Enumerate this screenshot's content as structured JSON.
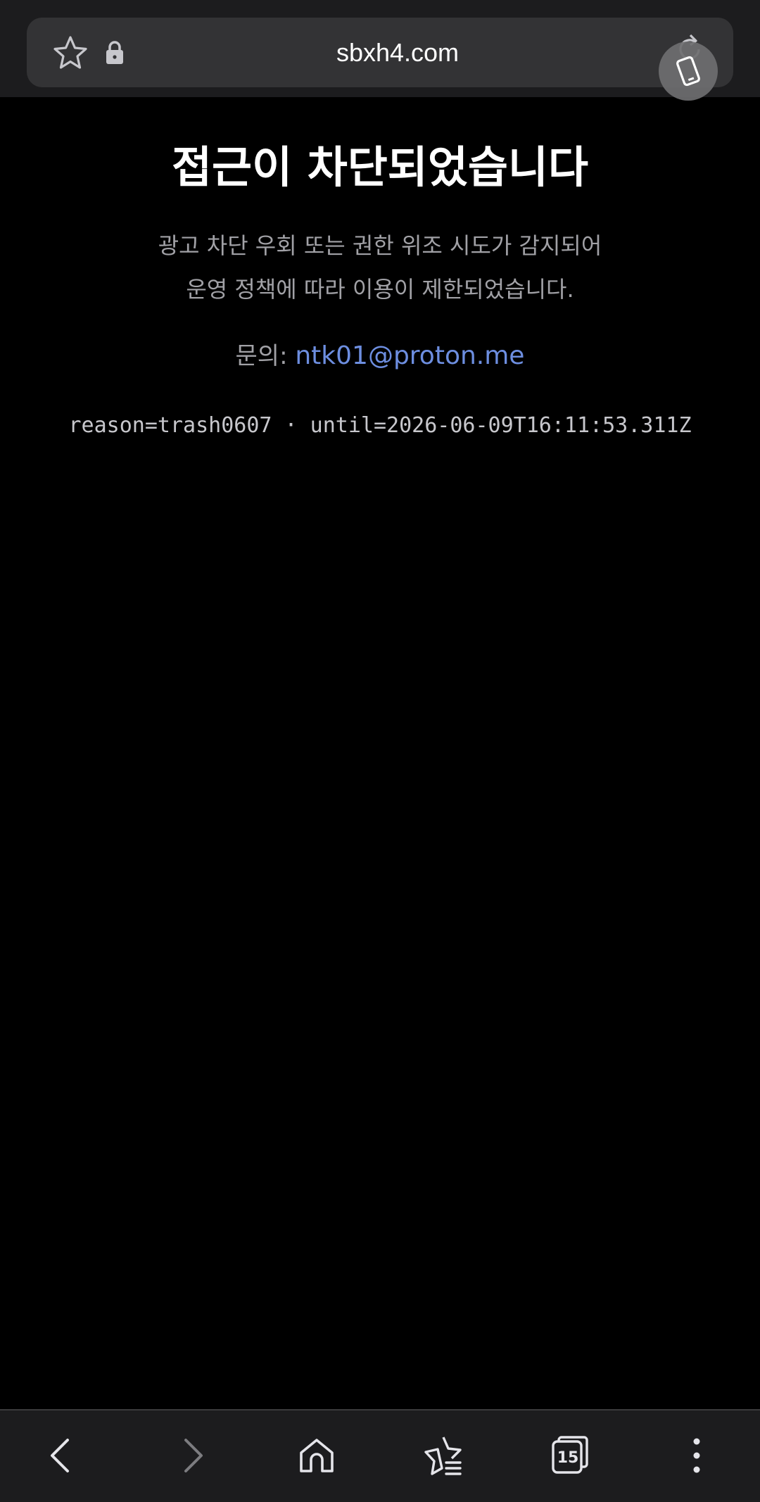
{
  "browser": {
    "url": "sbxh4.com",
    "icons": {
      "bookmark": "star-outline-icon",
      "security": "lock-icon",
      "reload": "reload-icon",
      "floating": "device-rotate-icon"
    }
  },
  "blocked": {
    "title": "접근이 차단되었습니다",
    "message_line1": "광고 차단 우회 또는 권한 위조 시도가 감지되어",
    "message_line2": "운영 정책에 따라 이용이 제한되었습니다.",
    "contact_label": "문의:",
    "contact_email": "ntk01@proton.me",
    "reason": "reason=trash0607 · until=2026-06-09T16:11:53.311Z"
  },
  "bottom_nav": {
    "tab_count": "15",
    "items": [
      "back-icon",
      "forward-icon",
      "home-icon",
      "bookmarks-icon",
      "tabs-icon",
      "more-icon"
    ]
  },
  "colors": {
    "background": "#000000",
    "bar": "#1c1c1e",
    "urlbar": "#333335",
    "link": "#6d8ee0",
    "muted_text": "#a1a1a6"
  }
}
